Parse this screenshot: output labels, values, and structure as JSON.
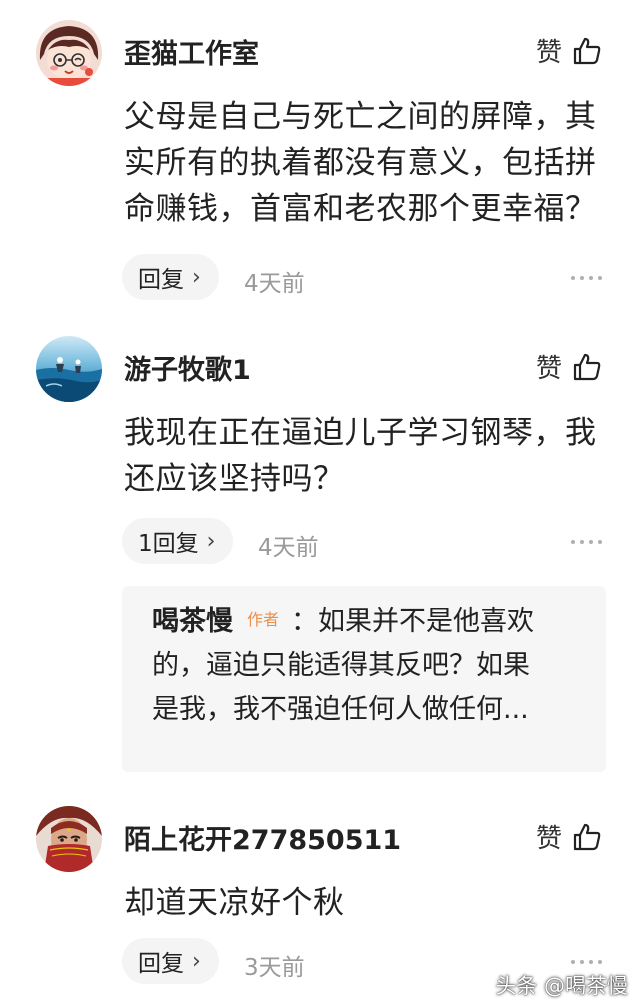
{
  "comments": [
    {
      "username": "歪猫工作室",
      "like_label": "赞",
      "text": "父母是自己与死亡之间的屏障，其实所有的执着都没有意义，包括拼命赚钱，首富和老农那个更幸福？",
      "reply_label": "回复",
      "time": "4天前",
      "avatar_icon": "cartoon-girl-avatar"
    },
    {
      "username": "游子牧歌1",
      "like_label": "赞",
      "text": "我现在正在逼迫儿子学习钢琴，我还应该坚持吗？",
      "reply_label": "1回复",
      "time": "4天前",
      "avatar_icon": "blue-scene-avatar",
      "sub_reply": {
        "author": "喝茶慢",
        "tag": "作者",
        "line1": "：如果并不是他喜欢",
        "line2": "的，逼迫只能适得其反吧？如果",
        "line3": "是我，我不强迫任何人做任何..."
      }
    },
    {
      "username": "陌上花开277850511",
      "like_label": "赞",
      "text": "却道天凉好个秋",
      "reply_label": "回复",
      "time": "3天前",
      "avatar_icon": "veiled-woman-avatar"
    }
  ],
  "watermark": "头条 @喝茶慢",
  "icons": {
    "like": "thumbs-up-icon",
    "more": "more-dots-icon",
    "chevron": "chevron-right-icon"
  },
  "colors": {
    "author_tag": "#e8904f",
    "time": "#9a9a9a",
    "pill_bg": "#f4f4f4",
    "sub_reply_bg": "#f6f6f6"
  }
}
